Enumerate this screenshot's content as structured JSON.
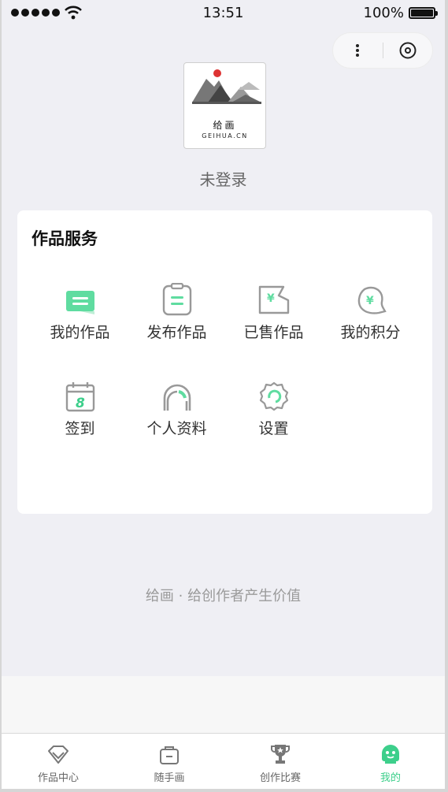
{
  "status_bar": {
    "time": "13:51",
    "battery": "100%"
  },
  "logo": {
    "title": "给画",
    "subtitle": "GEIHUA.CN"
  },
  "user": {
    "status": "未登录"
  },
  "services": {
    "title": "作品服务",
    "items": [
      {
        "label": "我的作品",
        "icon": "my-works-icon"
      },
      {
        "label": "发布作品",
        "icon": "publish-icon"
      },
      {
        "label": "已售作品",
        "icon": "sold-icon"
      },
      {
        "label": "我的积分",
        "icon": "points-icon"
      },
      {
        "label": "签到",
        "icon": "calendar-icon",
        "badge": "8"
      },
      {
        "label": "个人资料",
        "icon": "profile-icon"
      },
      {
        "label": "设置",
        "icon": "gear-icon"
      }
    ]
  },
  "slogan": "给画 · 给创作者产生价值",
  "tabbar": {
    "items": [
      {
        "label": "作品中心",
        "icon": "gem-icon"
      },
      {
        "label": "随手画",
        "icon": "bag-icon"
      },
      {
        "label": "创作比赛",
        "icon": "trophy-icon"
      },
      {
        "label": "我的",
        "icon": "face-icon",
        "active": true
      }
    ]
  },
  "colors": {
    "accent": "#3dcf8b",
    "background": "#efeff4"
  }
}
